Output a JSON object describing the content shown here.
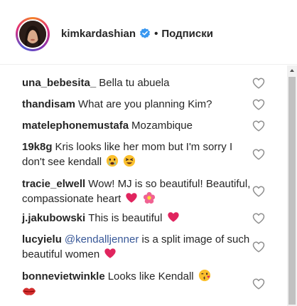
{
  "post_header": {
    "username": "kimkardashian",
    "separator": "•",
    "follow_label": "Подписки"
  },
  "comments": [
    {
      "user": "una_bebesita_",
      "text": "Bella tu abuela"
    },
    {
      "user": "thandisam",
      "text": "What are you planning Kim?"
    },
    {
      "user": "matelephonemustafa",
      "text": "Mozambique"
    },
    {
      "user": "19k8g",
      "text": "Kris looks like her mom but I'm sorry I don't see kendall"
    },
    {
      "user": "tracie_elwell",
      "text": "Wow! MJ is so beautiful! Beautiful, compassionate heart"
    },
    {
      "user": "j.jakubowski",
      "text": "This is beautiful"
    },
    {
      "user": "lucyielu",
      "mention": "@kendalljenner",
      "text": "is a split image of such beautiful women"
    },
    {
      "user": "bonnevietwinkle",
      "text": "Looks like Kendall"
    }
  ],
  "icons": {
    "like": "heart-outline-icon",
    "verified": "verified-badge-icon",
    "scroll": "scroll-up-arrow-icon"
  },
  "colors": {
    "verified_blue": "#3897f0",
    "mention_blue": "#385898",
    "heart_gray": "#8e8e8e"
  }
}
